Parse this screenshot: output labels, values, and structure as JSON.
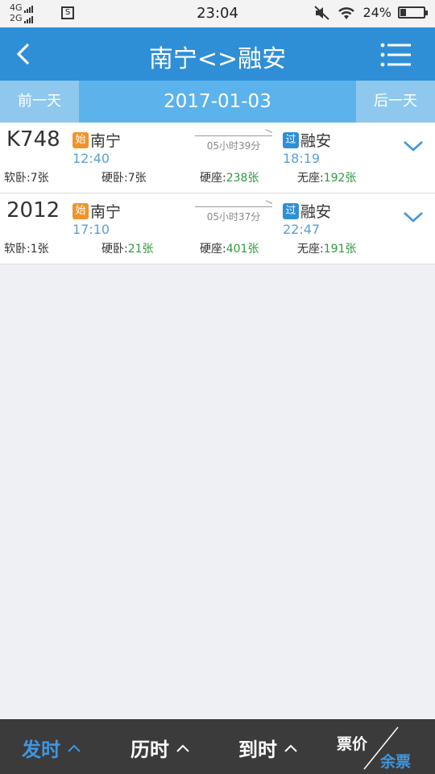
{
  "status": {
    "net_top": "4G",
    "net_bottom": "2G",
    "time": "23:04",
    "battery": "24%",
    "battery_level": 0.24
  },
  "header": {
    "title": "南宁<>融安"
  },
  "date_nav": {
    "prev": "前一天",
    "date": "2017-01-03",
    "next": "后一天"
  },
  "trains": [
    {
      "number": "K748",
      "dep_tag": "始",
      "dep_station": "南宁",
      "dep_time": "12:40",
      "duration": "05小时39分",
      "arr_tag": "过",
      "arr_station": "融安",
      "arr_time": "18:19",
      "seats": [
        {
          "label": "软卧:",
          "value": "7张"
        },
        {
          "label": "硬卧:",
          "value": "7张"
        },
        {
          "label": "硬座:",
          "value": "238张"
        },
        {
          "label": "无座:",
          "value": "192张"
        }
      ]
    },
    {
      "number": "2012",
      "dep_tag": "始",
      "dep_station": "南宁",
      "dep_time": "17:10",
      "duration": "05小时37分",
      "arr_tag": "过",
      "arr_station": "融安",
      "arr_time": "22:47",
      "seats": [
        {
          "label": "软卧:",
          "value": "1张"
        },
        {
          "label": "硬卧:",
          "value": "21张"
        },
        {
          "label": "硬座:",
          "value": "401张"
        },
        {
          "label": "无座:",
          "value": "191张"
        }
      ]
    }
  ],
  "bottom": {
    "sort_departure": "发时",
    "sort_duration": "历时",
    "sort_arrival": "到时",
    "toggle_price": "票价",
    "toggle_remaining": "余票"
  },
  "colors": {
    "primary": "#2f8fd6",
    "available": "#2e9a3d",
    "start_tag": "#f0932b"
  }
}
